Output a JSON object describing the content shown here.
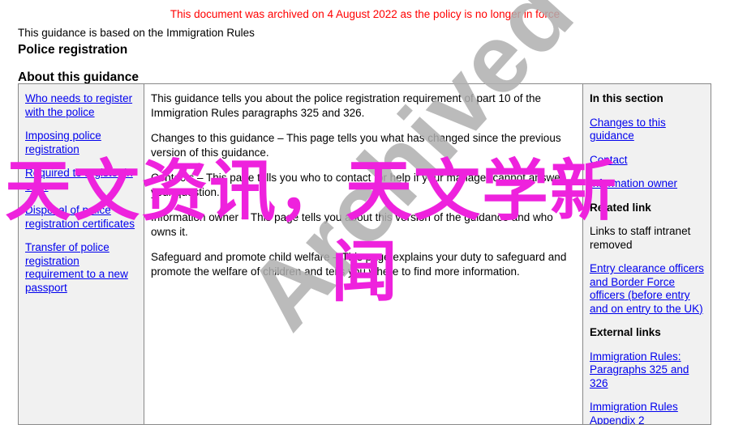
{
  "header": {
    "archived_banner": "This document was archived on 4 August 2022 as the policy is no longer in force",
    "based_on_line": "This guidance is based on the Immigration Rules",
    "page_title": "Police registration",
    "section_title": "About this guidance"
  },
  "nav_column": {
    "links": [
      {
        "label": "Who needs to register with the police"
      },
      {
        "label": "Imposing police registration"
      },
      {
        "label": "Required to register in error"
      },
      {
        "label": "Disposal of police registration certificates"
      },
      {
        "label": "Transfer of police registration requirement to a new passport"
      }
    ]
  },
  "content_column": {
    "paragraphs": [
      "This guidance tells you about the police registration requirement of part 10 of the Immigration Rules paragraphs 325 and 326.",
      "Changes to this guidance – This page tells you what has changed since the previous version of this guidance.",
      "Contacts – This page tells you who to contact for help if your manager cannot answer your question.",
      "Information owner – This page tells you about this version of the guidance and who owns it.",
      "Safeguard and promote child welfare – This page explains your duty to safeguard and promote the welfare of children and tells you where to find more information."
    ]
  },
  "section_column": {
    "heading": "In this section",
    "links": [
      {
        "label": "Changes to this guidance"
      },
      {
        "label": "Contact"
      },
      {
        "label": "Information owner"
      }
    ],
    "related_heading": "Related link",
    "related_text": "Links to staff intranet removed",
    "related_links": [
      {
        "label": "Entry clearance officers and Border Force officers (before entry and on entry to the UK)"
      }
    ],
    "external_heading": "External links",
    "external_links": [
      {
        "label": "Immigration Rules: Paragraphs 325 and 326"
      },
      {
        "label": "Immigration Rules Appendix 2"
      }
    ]
  },
  "watermarks": {
    "archived": "Archived",
    "overlay_line_1": "天文资讯，天文学新",
    "overlay_line_2": "闻"
  },
  "colors": {
    "archived_red": "#ff0000",
    "link_blue": "#0000ee",
    "overlay_magenta": "#ee22dd",
    "watermark_gray": "#b0b0b0",
    "panel_gray": "#f1f1f1",
    "border_gray": "#888888"
  }
}
